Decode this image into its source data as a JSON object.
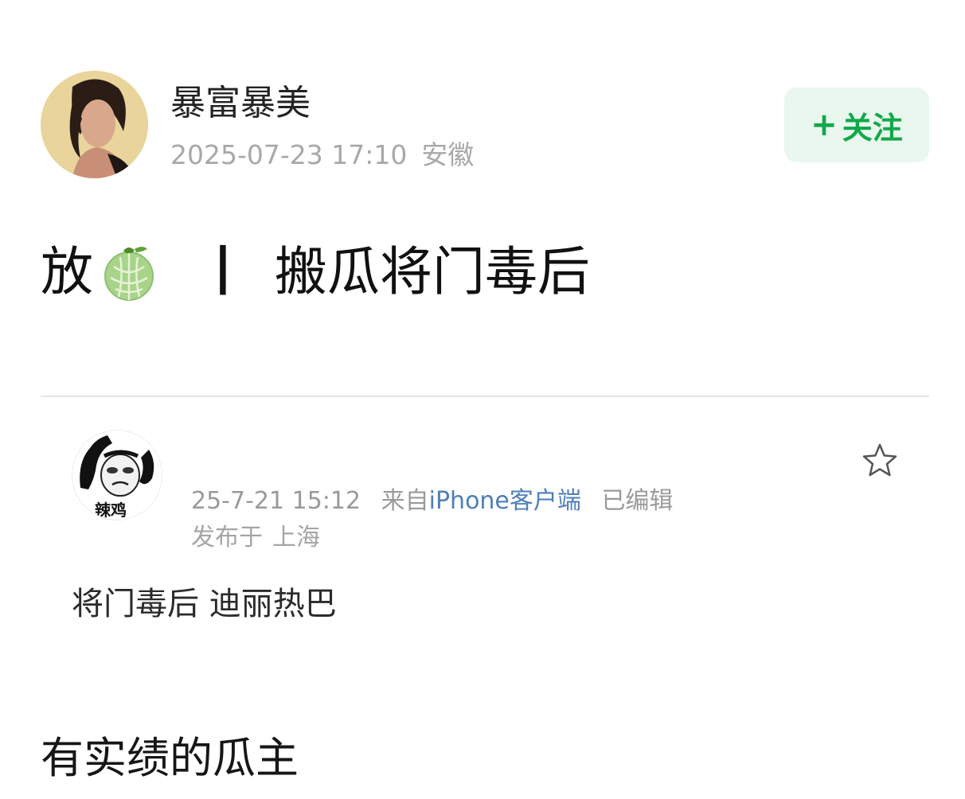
{
  "post": {
    "author_name": "暴富暴美",
    "datetime": "2025-07-23 17:10",
    "location": "安徽",
    "follow_label": "关注",
    "follow_icon": "plus-icon",
    "title_prefix": "放",
    "title_emoji": "melon-icon",
    "title_separator": "丨",
    "title_text": "搬瓜将门毒后"
  },
  "comment": {
    "avatar_caption": "辣鸡",
    "datetime": "25-7-21 15:12",
    "source_prefix": "来自",
    "client": "iPhone客户端",
    "edited": "已编辑",
    "published_prefix": "发布于",
    "published_location": "上海",
    "text": "将门毒后 迪丽热巴",
    "favorite_icon": "star-outline-icon"
  },
  "footer": {
    "text": "有实绩的瓜主"
  },
  "colors": {
    "follow_bg": "#e9f7ee",
    "follow_text": "#12a84b",
    "client_link": "#4f7fb8",
    "meta_gray": "#a8a8a8"
  }
}
